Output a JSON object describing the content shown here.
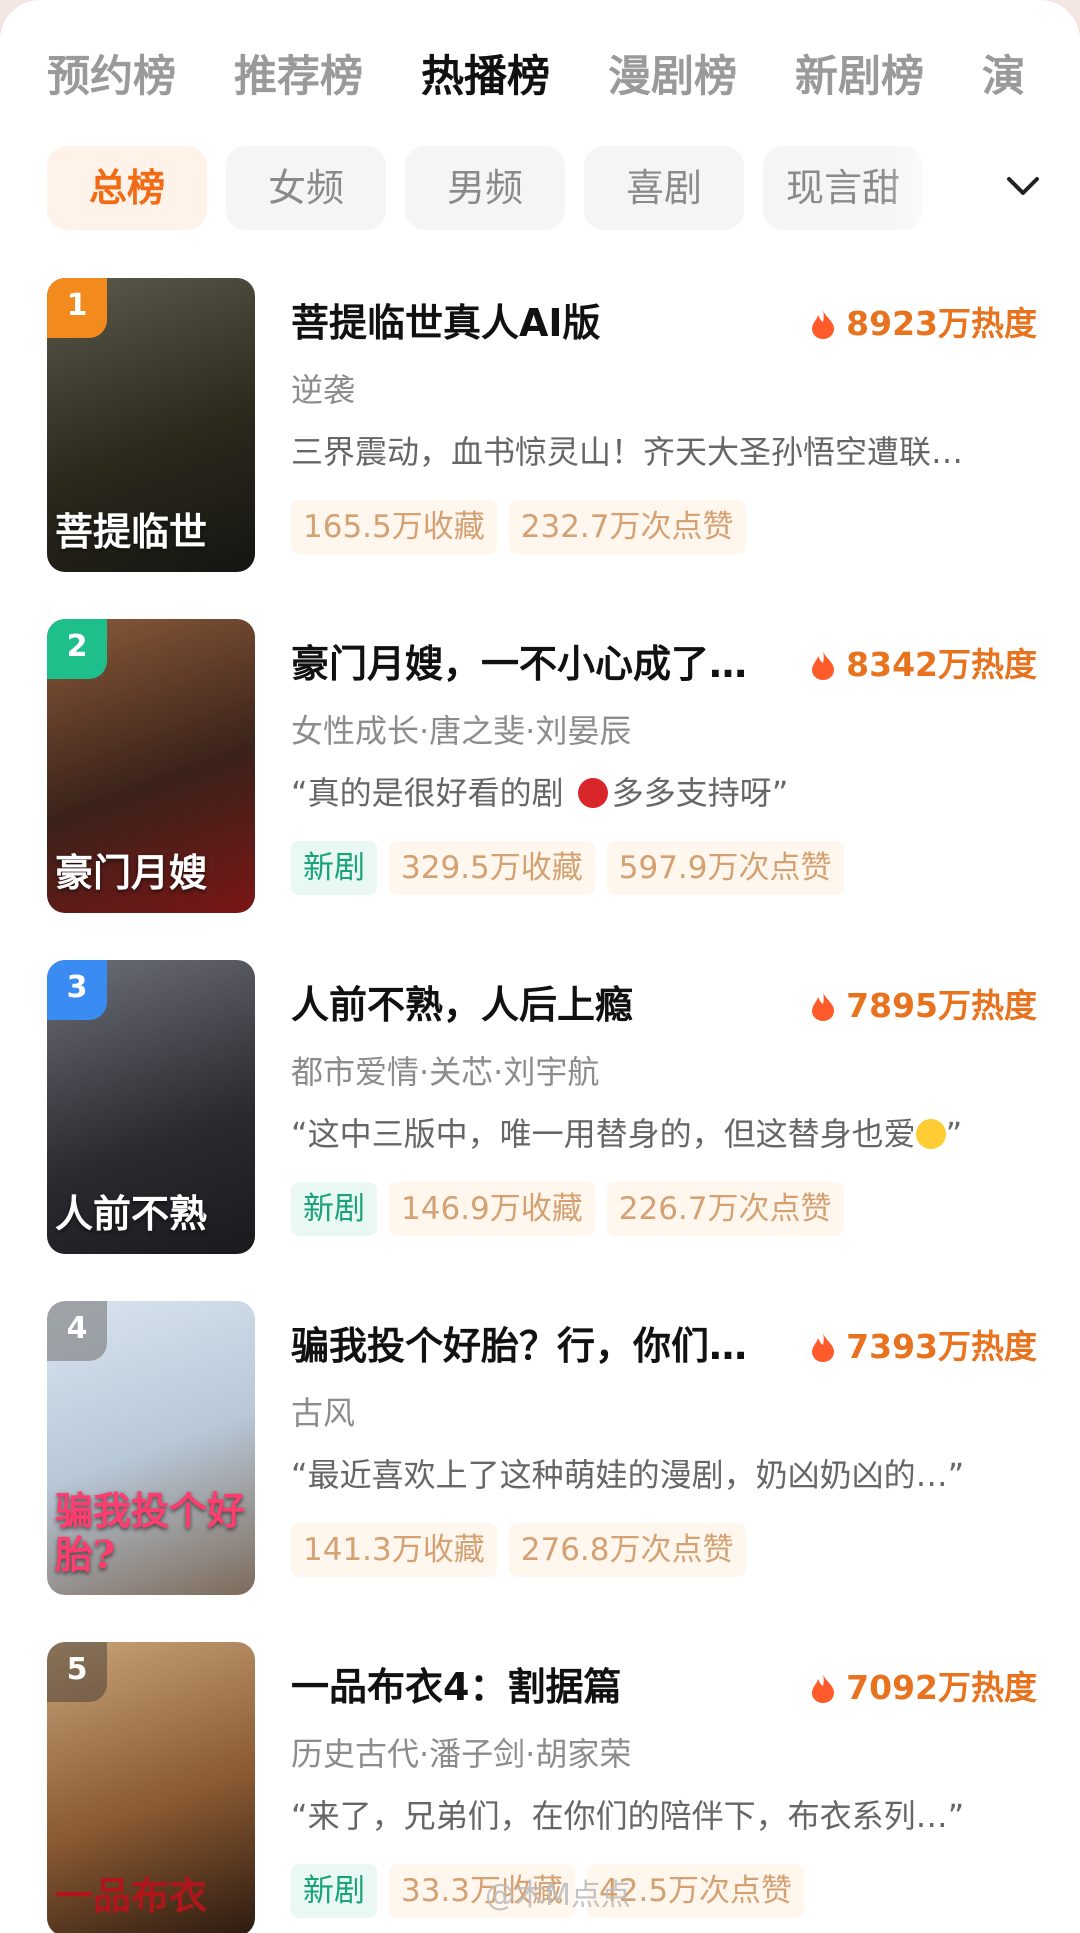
{
  "tabs": [
    "预约榜",
    "推荐榜",
    "热播榜",
    "漫剧榜",
    "新剧榜",
    "演"
  ],
  "active_tab": 2,
  "chips": [
    "总榜",
    "女频",
    "男频",
    "喜剧",
    "现言甜"
  ],
  "active_chip": 0,
  "colors": {
    "accent": "#f26a14",
    "heat": "#e8731f",
    "new_tag": "#1aa27a",
    "tag_text": "#d4a173"
  },
  "icons": {
    "dropdown": "chevron-down-icon",
    "heat": "flame-icon"
  },
  "items": [
    {
      "rank": "1",
      "rank_color": "#f28a1e",
      "poster_bg": "linear-gradient(160deg,#5b5a4c,#2c2a1d 55%,#151411)",
      "poster_text": "菩提临世",
      "title": "菩提临世真人AI版",
      "heat": "8923万热度",
      "meta": "逆袭",
      "desc": "三界震动，血书惊灵山！齐天大圣孙悟空遭联…",
      "tags": [
        {
          "text": "165.5万收藏",
          "new": false
        },
        {
          "text": "232.7万次点赞",
          "new": false
        }
      ]
    },
    {
      "rank": "2",
      "rank_color": "#1fbf8c",
      "poster_bg": "linear-gradient(160deg,#8a5a3a,#3b221a 55%,#7a1616)",
      "poster_text": "豪门月嫂",
      "title": "豪门月嫂，一不小心成了…",
      "heat": "8342万热度",
      "meta": "女性成长·唐之斐·刘晏辰",
      "desc_pre": "“真的是很好看的剧 ",
      "desc_post": "多多支持呀”",
      "tags": [
        {
          "text": "新剧",
          "new": true
        },
        {
          "text": "329.5万收藏",
          "new": false
        },
        {
          "text": "597.9万次点赞",
          "new": false
        }
      ]
    },
    {
      "rank": "3",
      "rank_color": "#3b8cf2",
      "poster_bg": "linear-gradient(160deg,#6d6f78,#2a2b30 60%,#1a1a1e)",
      "poster_text": "人前不熟",
      "title": "人前不熟，人后上瘾",
      "heat": "7895万热度",
      "meta": "都市爱情·关芯·刘宇航",
      "desc_pre": "“这中三版中，唯一用替身的，但这替身也爱",
      "desc_post": "”",
      "tags": [
        {
          "text": "新剧",
          "new": true
        },
        {
          "text": "146.9万收藏",
          "new": false
        },
        {
          "text": "226.7万次点赞",
          "new": false
        }
      ]
    },
    {
      "rank": "4",
      "rank_color": "rgba(120,120,120,0.6)",
      "poster_bg": "linear-gradient(160deg,#d9e4f0,#b8c8d8 50%,#7d6a5a)",
      "poster_text": "骗我投个好胎?",
      "title": "骗我投个好胎？行，你们…",
      "heat": "7393万热度",
      "meta": "古风",
      "desc": "“最近喜欢上了这种萌娃的漫剧，奶凶奶凶的…”",
      "tags": [
        {
          "text": "141.3万收藏",
          "new": false
        },
        {
          "text": "276.8万次点赞",
          "new": false
        }
      ]
    },
    {
      "rank": "5",
      "rank_color": "rgba(40,40,40,0.4)",
      "poster_bg": "linear-gradient(160deg,#c8a37a,#8a5a32 55%,#2c1a10)",
      "poster_text": "一品布衣",
      "title": "一品布衣4：割据篇",
      "heat": "7092万热度",
      "meta": "历史古代·潘子剑·胡家荣",
      "desc": "“来了，兄弟们，在你们的陪伴下，布衣系列…”",
      "tags": [
        {
          "text": "新剧",
          "new": true
        },
        {
          "text": "33.3万收藏",
          "new": false
        },
        {
          "text": "42.5万次点赞",
          "new": false
        }
      ]
    }
  ],
  "watermark": "@木M点点"
}
